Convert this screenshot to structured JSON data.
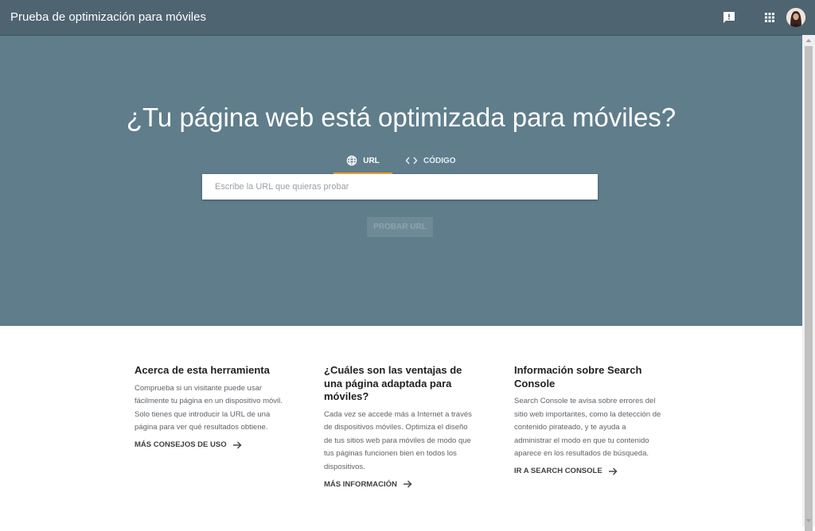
{
  "header": {
    "title": "Prueba de optimización para móviles",
    "icons": [
      "feedback-icon",
      "apps-grid-icon",
      "user-avatar"
    ]
  },
  "hero": {
    "title": "¿Tu página web está optimizada para móviles?",
    "tabs": [
      {
        "label": "URL",
        "icon": "globe-icon",
        "selected": true
      },
      {
        "label": "CÓDIGO",
        "icon": "code-icon",
        "selected": false
      }
    ],
    "input": {
      "placeholder": "Escribe la URL que quieras probar",
      "value": ""
    },
    "button_label": "PROBAR URL",
    "colors": {
      "background": "#607d8b",
      "tab_indicator": "#f4a533"
    }
  },
  "sections": [
    {
      "title": "Acerca de esta herramienta",
      "text": "Comprueba si un visitante puede usar fácilmente tu página en un dispositivo móvil. Solo tienes que introducir la URL de una página para ver qué resultados obtiene.",
      "link": "MÁS CONSEJOS DE USO"
    },
    {
      "title": "¿Cuáles son las ventajas de una página adaptada para móviles?",
      "text": "Cada vez se accede más a Internet a través de dispositivos móviles. Optimiza el diseño de tus sitios web para móviles de modo que tus páginas funcionen bien en todos los dispositivos.",
      "link": "MÁS INFORMACIÓN"
    },
    {
      "title": "Información sobre Search Console",
      "text": "Search Console te avisa sobre errores del sitio web importantes, como la detección de contenido pirateado, y te ayuda a administrar el modo en que tu contenido aparece en los resultados de búsqueda.",
      "link": "IR A SEARCH CONSOLE"
    }
  ]
}
